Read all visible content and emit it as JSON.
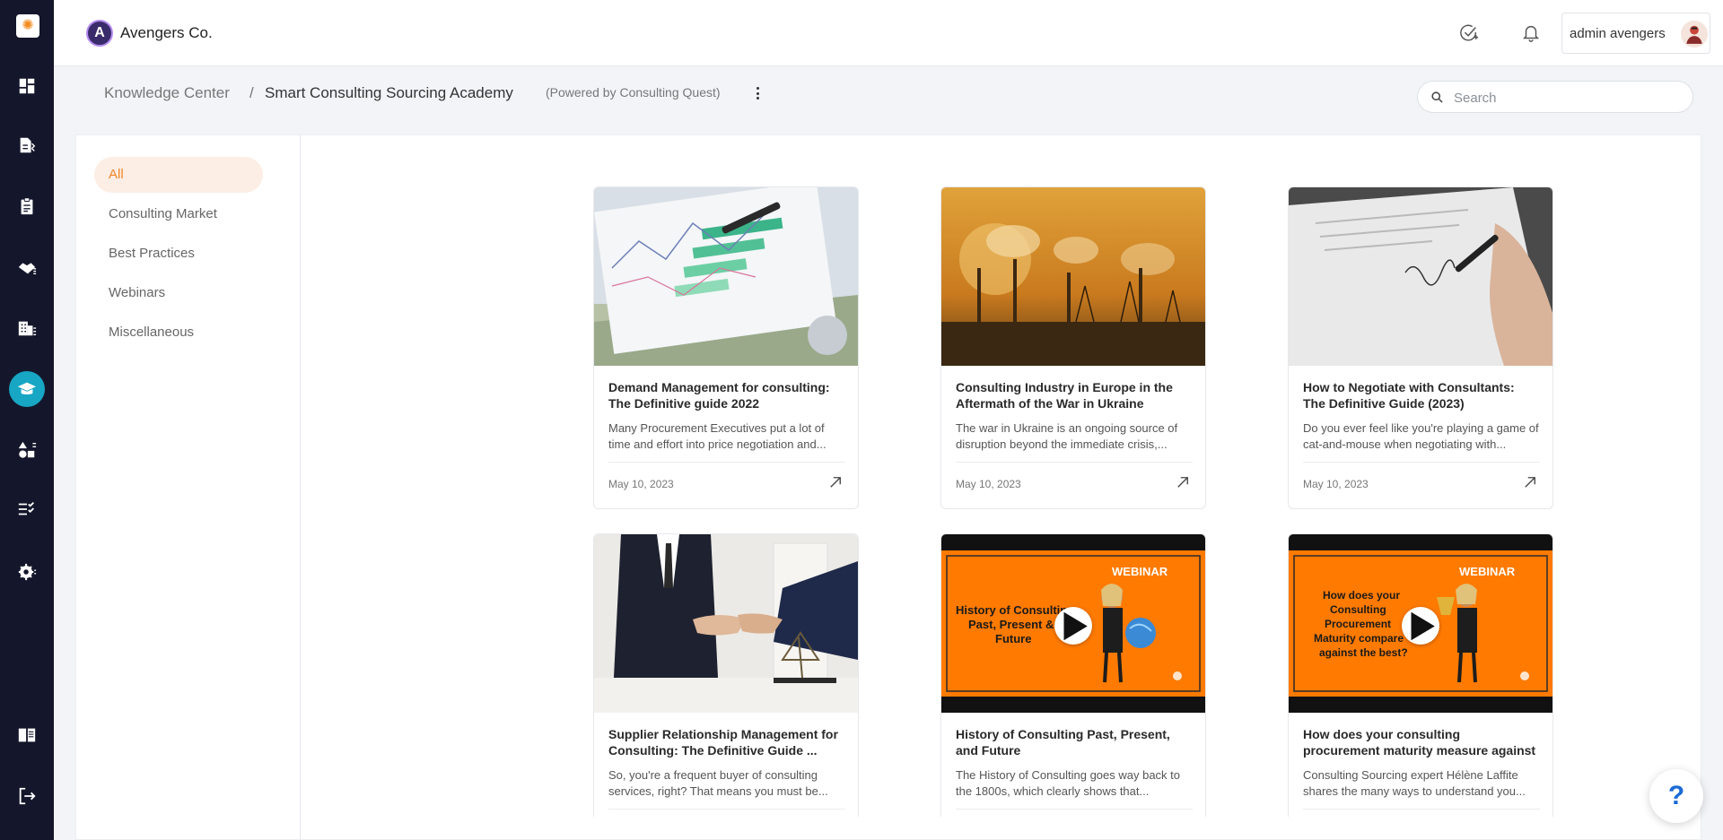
{
  "app": {
    "name": "Avengers Co."
  },
  "user": {
    "name": "admin avengers"
  },
  "breadcrumb": {
    "root": "Knowledge Center",
    "separator": "/",
    "current": "Smart Consulting Sourcing Academy",
    "powered_by": "(Powered by Consulting Quest)"
  },
  "search": {
    "placeholder": "Search"
  },
  "categories": [
    "All",
    "Consulting Market",
    "Best Practices",
    "Webinars",
    "Miscellaneous"
  ],
  "active_category": "All",
  "articles": [
    {
      "title": "Demand Management for consulting: The Definitive guide 2022",
      "description": "Many Procurement Executives put a lot of time and effort into price negotiation and...",
      "date": "May 10, 2023"
    },
    {
      "title": "Consulting Industry in Europe in the Aftermath of the War in Ukraine",
      "description": "The war in Ukraine is an ongoing source of disruption beyond the immediate crisis,...",
      "date": "May 10, 2023"
    },
    {
      "title": "How to Negotiate with Consultants: The Definitive Guide (2023)",
      "description": "Do you ever feel like you're playing a game of cat-and-mouse when negotiating with...",
      "date": "May 10, 2023"
    },
    {
      "title": "Supplier Relationship Management for Consulting: The Definitive Guide ...",
      "description": "So, you're a frequent buyer of consulting services, right? That means you must be...",
      "date": ""
    },
    {
      "title": "History of Consulting Past, Present, and Future",
      "description": "The History of Consulting goes way back to the 1800s, which clearly shows that...",
      "date": "",
      "webinar_badge": "WEBINAR",
      "thumb_text": [
        "History of Consulting:",
        "Past, Present &",
        "Future"
      ]
    },
    {
      "title": "How does your consulting procurement maturity measure against the be...",
      "description": "Consulting Sourcing expert Hélène Laffite shares the many ways to understand you...",
      "date": "",
      "webinar_badge": "WEBINAR",
      "thumb_text": [
        "How does your",
        "Consulting",
        "Procurement",
        "Maturity compare",
        "against the best?"
      ]
    }
  ],
  "help": {
    "label": "?"
  },
  "colors": {
    "accent": "#f0862a",
    "rail": "#14172b",
    "rail_active": "#17a6c4",
    "webinar": "#ff7a00"
  },
  "icons": {
    "rail": [
      "dashboard-icon",
      "sourcing-icon",
      "clipboard-icon",
      "handshake-icon",
      "building-icon",
      "academy-icon",
      "shapes-icon",
      "checklist-icon",
      "settings-icon",
      "book-icon",
      "logout-icon"
    ],
    "top": [
      "task-check-icon",
      "bell-icon"
    ]
  }
}
